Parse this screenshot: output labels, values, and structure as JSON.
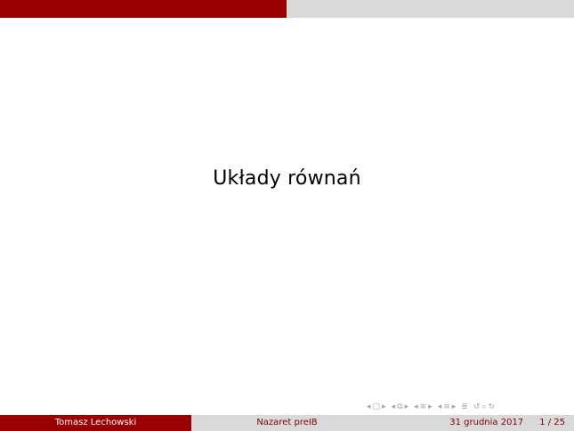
{
  "slide": {
    "title": "Układy równań"
  },
  "footer": {
    "author": "Tomasz Lechowski",
    "institute": "Nazaret preIB",
    "date": "31 grudnia 2017",
    "page": "1 / 25"
  },
  "navigation": {
    "icons": [
      "frame-prev-icon",
      "frame-icon",
      "frame-next-icon",
      "subsection-prev-icon",
      "subsection-icon",
      "subsection-next-icon",
      "section-prev-icon",
      "section-icon",
      "section-next-icon",
      "section-doc-prev-icon",
      "section-doc-icon",
      "section-doc-next-icon",
      "document-icon",
      "find-icon",
      "undo-icon"
    ]
  },
  "colors": {
    "accent": "#9b0000",
    "bar_gray": "#d9d9d9",
    "footer_text": "#7f0000",
    "nav_gray": "#9aa6b6"
  }
}
